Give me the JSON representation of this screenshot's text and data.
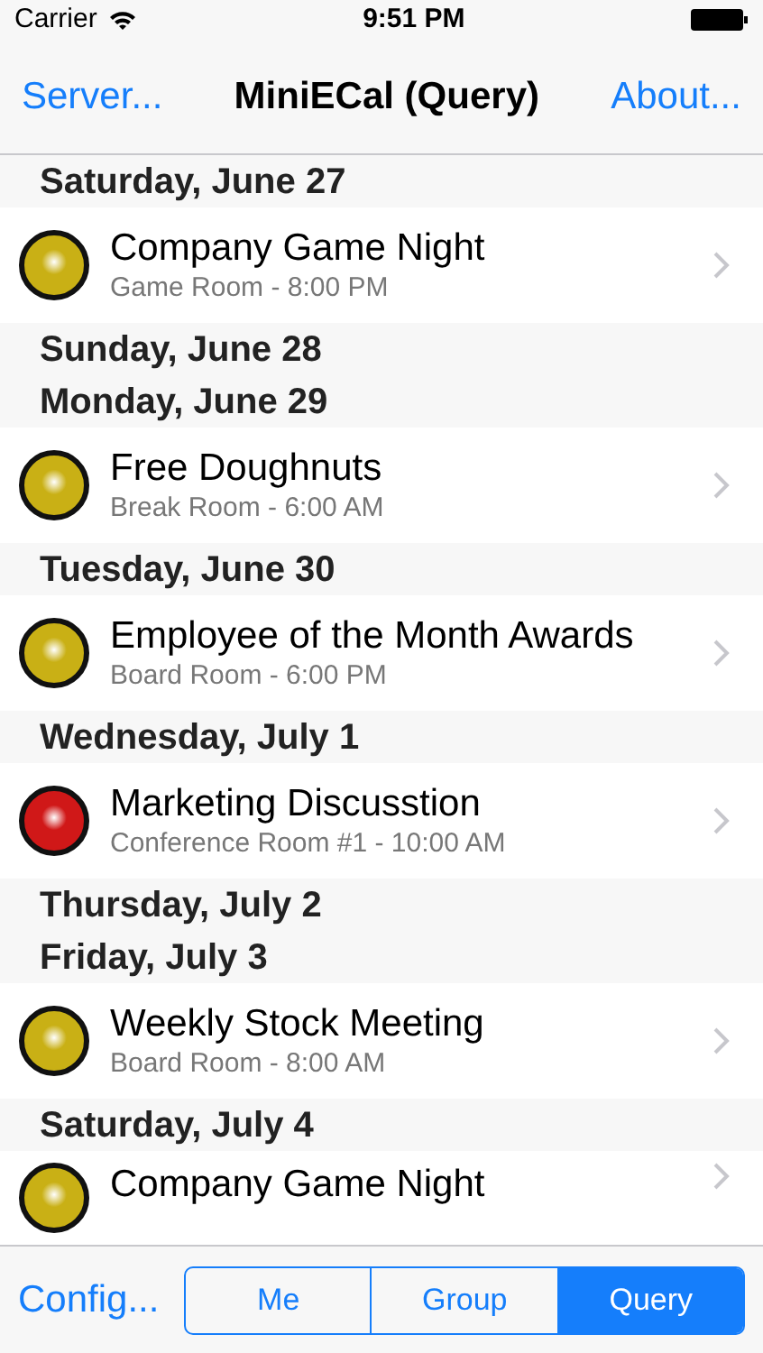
{
  "status_bar": {
    "carrier": "Carrier",
    "time": "9:51 PM"
  },
  "nav": {
    "left": "Server...",
    "title": "MiniECal (Query)",
    "right": "About..."
  },
  "items": [
    {
      "kind": "header",
      "text": "Saturday, June 27"
    },
    {
      "kind": "event",
      "title": "Company Game Night",
      "subtitle": "Game Room - 8:00 PM",
      "color": "#c9b015"
    },
    {
      "kind": "header",
      "text": "Sunday, June 28"
    },
    {
      "kind": "header",
      "text": "Monday, June 29"
    },
    {
      "kind": "event",
      "title": "Free Doughnuts",
      "subtitle": "Break Room - 6:00 AM",
      "color": "#c9b015"
    },
    {
      "kind": "header",
      "text": "Tuesday, June 30"
    },
    {
      "kind": "event",
      "title": "Employee of the Month Awards",
      "subtitle": "Board Room - 6:00 PM",
      "color": "#c9b015"
    },
    {
      "kind": "header",
      "text": "Wednesday, July 1"
    },
    {
      "kind": "event",
      "title": "Marketing Discusstion",
      "subtitle": "Conference Room #1 - 10:00 AM",
      "color": "#d01818"
    },
    {
      "kind": "header",
      "text": "Thursday, July 2"
    },
    {
      "kind": "header",
      "text": "Friday, July 3"
    },
    {
      "kind": "event",
      "title": "Weekly Stock Meeting",
      "subtitle": "Board Room - 8:00 AM",
      "color": "#c9b015"
    },
    {
      "kind": "header",
      "text": "Saturday, July 4"
    },
    {
      "kind": "event",
      "title": "Company Game Night",
      "color": "#c9b015"
    }
  ],
  "toolbar": {
    "config": "Config...",
    "segments": [
      {
        "label": "Me",
        "selected": false
      },
      {
        "label": "Group",
        "selected": false
      },
      {
        "label": "Query",
        "selected": true
      }
    ]
  }
}
